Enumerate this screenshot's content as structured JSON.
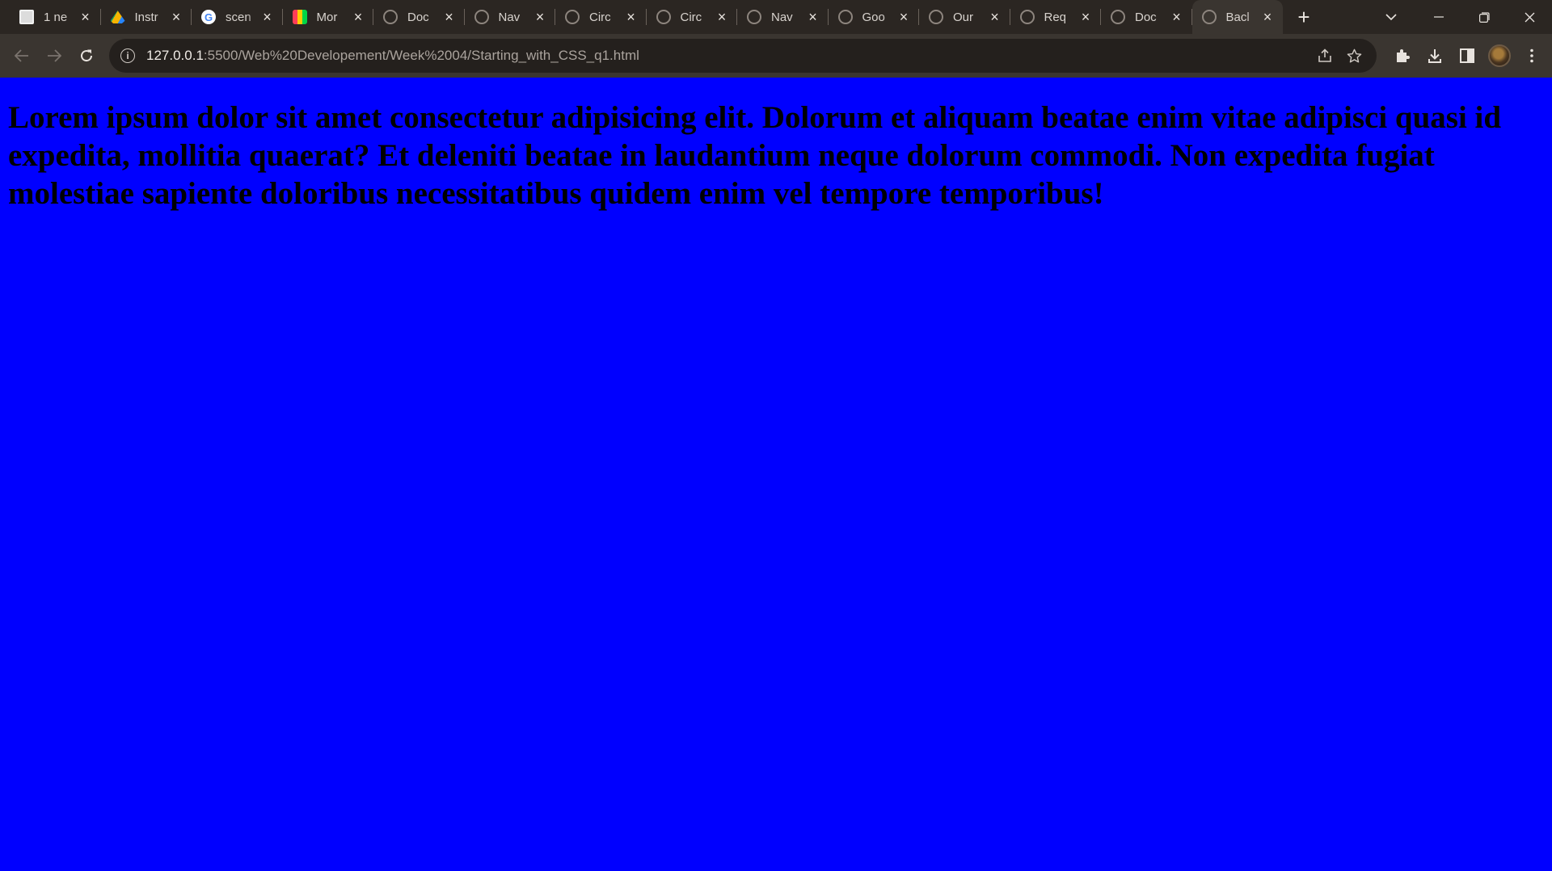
{
  "browser": {
    "tabs": [
      {
        "title": "1 ne",
        "favicon": "wordpress-icon",
        "active": false
      },
      {
        "title": "Instr",
        "favicon": "google-drive-icon",
        "active": false
      },
      {
        "title": "scen",
        "favicon": "google-icon",
        "active": false
      },
      {
        "title": "Mor",
        "favicon": "monday-icon",
        "active": false
      },
      {
        "title": "Doc",
        "favicon": "globe-icon",
        "active": false
      },
      {
        "title": "Nav",
        "favicon": "globe-icon",
        "active": false
      },
      {
        "title": "Circ",
        "favicon": "globe-icon",
        "active": false
      },
      {
        "title": "Circ",
        "favicon": "globe-icon",
        "active": false
      },
      {
        "title": "Nav",
        "favicon": "globe-icon",
        "active": false
      },
      {
        "title": "Goo",
        "favicon": "globe-icon",
        "active": false
      },
      {
        "title": "Our",
        "favicon": "globe-icon",
        "active": false
      },
      {
        "title": "Req",
        "favicon": "globe-icon",
        "active": false
      },
      {
        "title": "Doc",
        "favicon": "globe-icon",
        "active": false
      },
      {
        "title": "Bacl",
        "favicon": "globe-icon",
        "active": true
      }
    ],
    "url_host": "127.0.0.1",
    "url_path": ":5500/Web%20Developement/Week%2004/Starting_with_CSS_q1.html",
    "colors": {
      "tabstrip": "#2b2622",
      "toolbar": "#3a3530",
      "omnibox": "#24201d"
    }
  },
  "page": {
    "heading": "Lorem ipsum dolor sit amet consectetur adipisicing elit. Dolorum et aliquam beatae enim vitae adipisci quasi id expedita, mollitia quaerat? Et deleniti beatae in laudantium neque dolorum commodi. Non expedita fugiat molestiae sapiente doloribus necessitatibus quidem enim vel tempore temporibus!",
    "background_color": "#0000ff",
    "text_color": "#000000"
  }
}
